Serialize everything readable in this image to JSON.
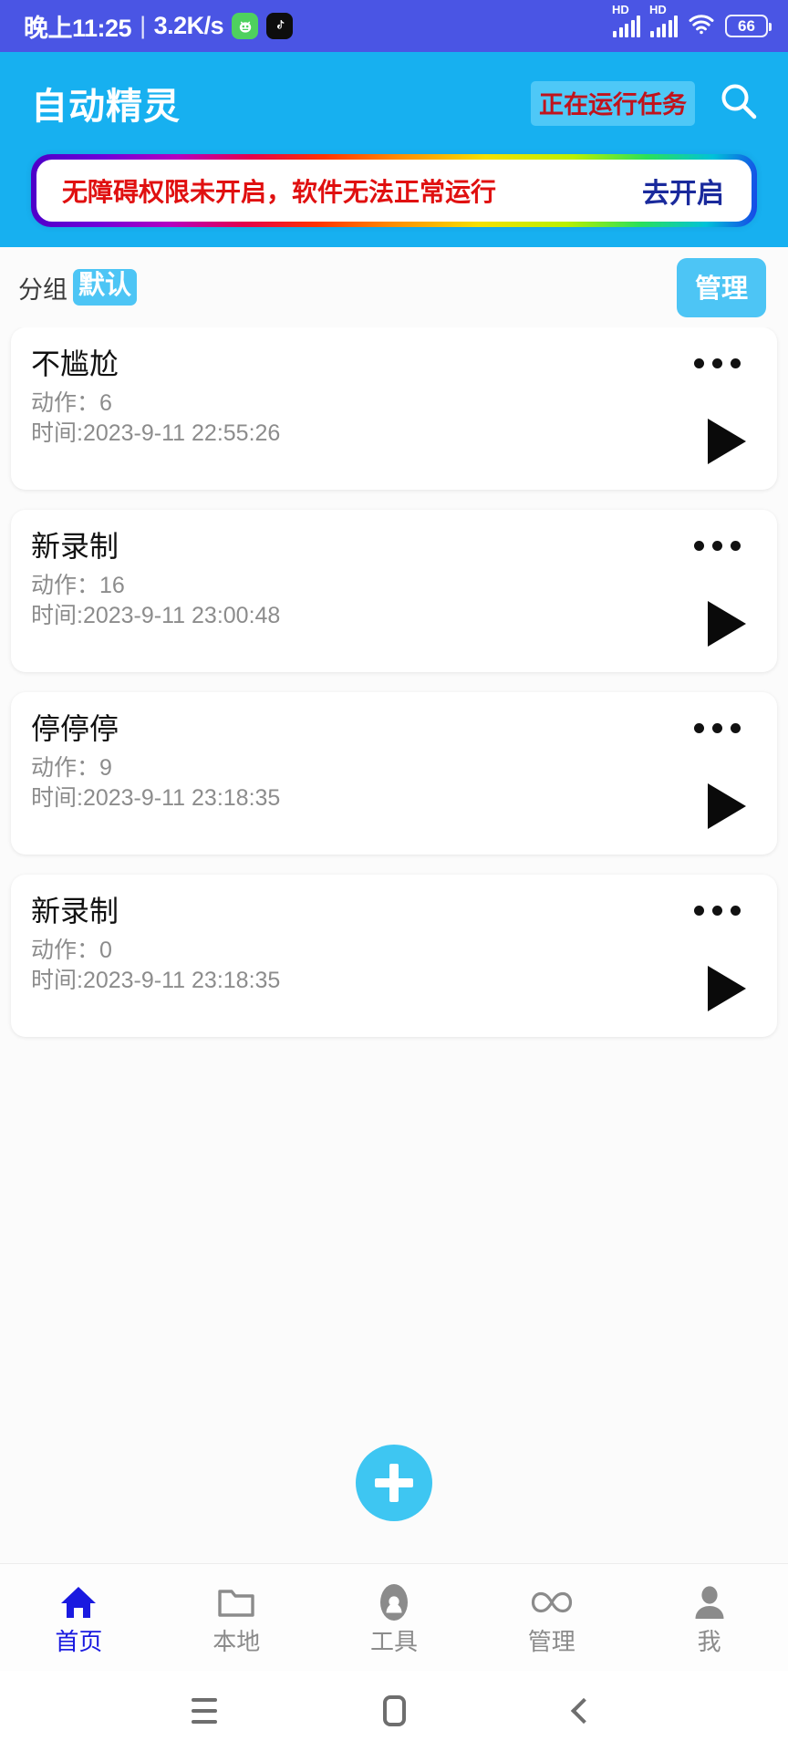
{
  "status_bar": {
    "time": "晚上11:25",
    "separator": "|",
    "network_speed": "3.2K/s",
    "app_icons": [
      "smiley-app-icon",
      "tiktok-app-icon"
    ],
    "signal_label_1": "HD",
    "signal_label_2": "HD",
    "wifi_icon": "wifi-icon",
    "battery_level": "66",
    "colors": {
      "background": "#4a55e4",
      "foreground": "#ffffff"
    }
  },
  "header": {
    "title": "自动精灵",
    "running_badge": "正在运行任务",
    "search_icon": "search-icon",
    "colors": {
      "background": "#17b0f0",
      "badge_background": "#4ec8f7",
      "badge_text": "#c0131c"
    }
  },
  "warning_banner": {
    "message": "无障碍权限未开启，软件无法正常运行",
    "action_label": "去开启",
    "colors": {
      "message": "#e01010",
      "action": "#1a2a9c",
      "fill": "#ffffff"
    }
  },
  "group_row": {
    "label": "分组",
    "selected_group": "默认",
    "manage_label": "管理",
    "colors": {
      "chip": "#4dc5f5",
      "button": "#4dc5f5"
    }
  },
  "tasks": [
    {
      "title": "不尴尬",
      "actions": "动作：6",
      "time": "时间:2023-9-11 22:55:26",
      "menu_icon": "more-options-icon",
      "play_icon": "play-icon"
    },
    {
      "title": "新录制",
      "actions": "动作：16",
      "time": "时间:2023-9-11 23:00:48",
      "menu_icon": "more-options-icon",
      "play_icon": "play-icon"
    },
    {
      "title": "停停停",
      "actions": "动作：9",
      "time": "时间:2023-9-11 23:18:35",
      "menu_icon": "more-options-icon",
      "play_icon": "play-icon"
    },
    {
      "title": "新录制",
      "actions": "动作：0",
      "time": "时间:2023-9-11 23:18:35",
      "menu_icon": "more-options-icon",
      "play_icon": "play-icon"
    }
  ],
  "fab": {
    "icon": "plus-icon",
    "color": "#3ec6f2"
  },
  "bottom_nav": {
    "active_color": "#1a1ae0",
    "inactive_color": "#8b8b8b",
    "items": [
      {
        "label": "首页",
        "icon": "home-icon",
        "active": true
      },
      {
        "label": "本地",
        "icon": "folder-icon",
        "active": false
      },
      {
        "label": "工具",
        "icon": "cloud-icon",
        "active": false
      },
      {
        "label": "管理",
        "icon": "infinity-icon",
        "active": false
      },
      {
        "label": "我",
        "icon": "person-icon",
        "active": false
      }
    ]
  },
  "system_nav": {
    "recents_icon": "menu-icon",
    "home_icon": "home-square-icon",
    "back_icon": "back-chevron-icon"
  }
}
